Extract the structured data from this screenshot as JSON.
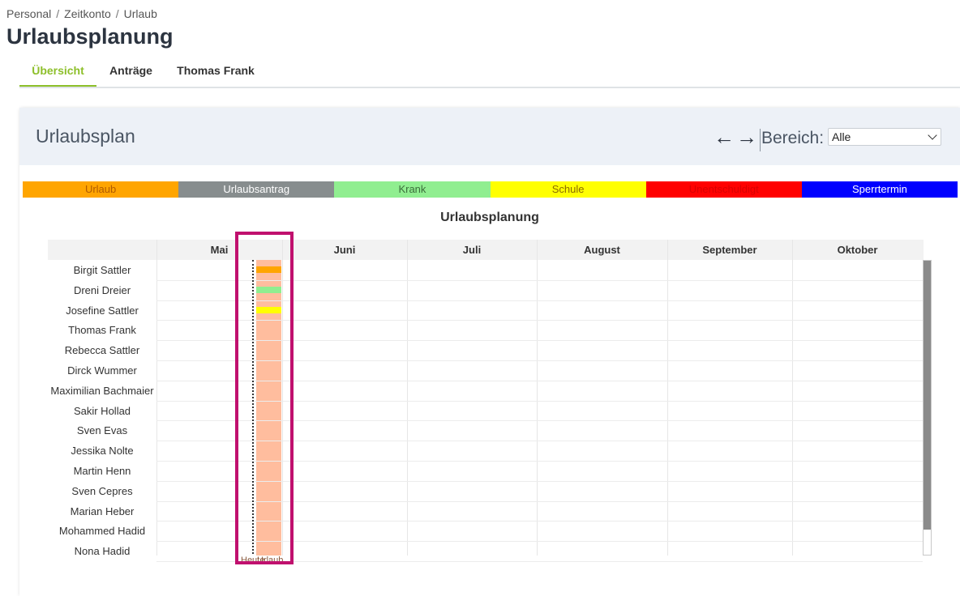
{
  "breadcrumb": {
    "items": [
      "Personal",
      "Zeitkonto",
      "Urlaub"
    ],
    "sep": "/"
  },
  "page_title": "Urlaubsplanung",
  "tabs": [
    {
      "label": "Übersicht",
      "active": true
    },
    {
      "label": "Anträge",
      "active": false
    },
    {
      "label": "Thomas Frank",
      "active": false
    }
  ],
  "card": {
    "title": "Urlaubsplan",
    "prev_icon": "arrow-left-icon",
    "next_icon": "arrow-right-icon",
    "prev_arrow": "←",
    "next_arrow": "→",
    "bereich_label": "Bereich:",
    "bereich_value": "Alle"
  },
  "legend": [
    {
      "label": "Urlaub",
      "bg": "#ffa500",
      "fg": "#b05a00"
    },
    {
      "label": "Urlaubsantrag",
      "bg": "#878d8e",
      "fg": "#ffffff"
    },
    {
      "label": "Krank",
      "bg": "#90ee90",
      "fg": "#3c6e3c"
    },
    {
      "label": "Schule",
      "bg": "#ffff00",
      "fg": "#8a6a00"
    },
    {
      "label": "Unentschuldigt",
      "bg": "#ff0000",
      "fg": "#d80000"
    },
    {
      "label": "Sperrtermin",
      "bg": "#0000ff",
      "fg": "#ffffff"
    }
  ],
  "chart": {
    "title": "Urlaubsplanung",
    "months": [
      "Mai",
      "Juni",
      "Juli",
      "August",
      "September",
      "Oktober"
    ],
    "employees": [
      "Birgit Sattler",
      "Dreni Dreier",
      "Josefine Sattler",
      "Thomas Frank",
      "Rebecca Sattler",
      "Dirck Wummer",
      "Maximilian Bachmaier",
      "Sakir Hollad",
      "Sven Evas",
      "Jessika Nolte",
      "Martin Henn",
      "Sven Cepres",
      "Marian Heber",
      "Mohammed Hadid",
      "Nona Hadid"
    ],
    "band_label": "Urlaub",
    "today_label": "Heute",
    "band_color": "#ffbd9e",
    "entries": [
      {
        "employee": "Birgit Sattler",
        "type": "Urlaub",
        "color": "#ffa500"
      },
      {
        "employee": "Dreni Dreier",
        "type": "Krank",
        "color": "#90ee90"
      },
      {
        "employee": "Josefine Sattler",
        "type": "Schule",
        "color": "#ffff00"
      }
    ]
  },
  "highlight_color": "#c0106e"
}
